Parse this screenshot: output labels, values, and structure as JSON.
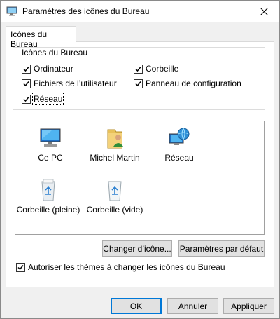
{
  "window": {
    "title": "Paramètres des icônes du Bureau"
  },
  "tabs": [
    {
      "label": "Icônes du Bureau"
    }
  ],
  "group": {
    "legend": "Icônes du Bureau",
    "checkboxes": [
      {
        "label": "Ordinateur",
        "checked": true
      },
      {
        "label": "Corbeille",
        "checked": true
      },
      {
        "label": "Fichiers de l’utilisateur",
        "checked": true
      },
      {
        "label": "Panneau de configuration",
        "checked": true
      },
      {
        "label": "Réseau",
        "checked": true
      }
    ]
  },
  "icons": [
    {
      "caption": "Ce PC",
      "icon": "computer-icon"
    },
    {
      "caption": "Michel Martin",
      "icon": "user-folder-icon"
    },
    {
      "caption": "Réseau",
      "icon": "network-icon"
    },
    {
      "caption": "Corbeille (pleine)",
      "icon": "recycle-bin-full-icon"
    },
    {
      "caption": "Corbeille (vide)",
      "icon": "recycle-bin-empty-icon"
    }
  ],
  "buttons": {
    "change_icon": "Changer d’icône...",
    "default_settings": "Paramètres par défaut",
    "ok": "OK",
    "cancel": "Annuler",
    "apply": "Appliquer"
  },
  "themes_checkbox": {
    "label": "Autoriser les thèmes à changer les icônes du Bureau",
    "checked": true
  },
  "colors": {
    "accent": "#0078d7",
    "window_bg": "#f0f0f0"
  }
}
